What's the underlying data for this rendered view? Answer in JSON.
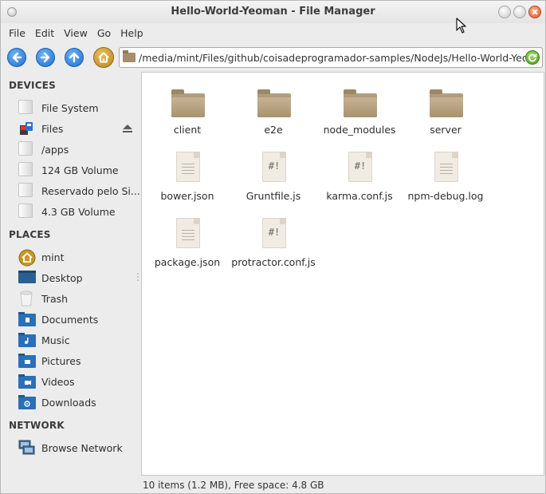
{
  "window": {
    "title": "Hello-World-Yeoman - File Manager"
  },
  "menubar": {
    "items": [
      "File",
      "Edit",
      "View",
      "Go",
      "Help"
    ]
  },
  "toolbar": {
    "back_icon": "back-arrow-icon",
    "forward_icon": "forward-arrow-icon",
    "up_icon": "up-arrow-icon",
    "home_icon": "home-icon",
    "path": "/media/mint/Files/github/coisadeprogramador-samples/NodeJs/Hello-World-Yeoman/",
    "reload_icon": "reload-icon"
  },
  "sidebar": {
    "devices": {
      "heading": "DEVICES",
      "items": [
        {
          "label": "File System",
          "icon": "drive-icon"
        },
        {
          "label": "Files",
          "icon": "removable-drive-icon"
        },
        {
          "label": "/apps",
          "icon": "drive-icon"
        },
        {
          "label": "124 GB Volume",
          "icon": "drive-icon"
        },
        {
          "label": "Reservado pelo Si...",
          "icon": "drive-icon"
        },
        {
          "label": "4.3 GB Volume",
          "icon": "drive-icon"
        }
      ]
    },
    "places": {
      "heading": "PLACES",
      "items": [
        {
          "label": "mint",
          "icon": "home-folder-icon"
        },
        {
          "label": "Desktop",
          "icon": "desktop-icon"
        },
        {
          "label": "Trash",
          "icon": "trash-icon"
        },
        {
          "label": "Documents",
          "icon": "documents-folder-icon"
        },
        {
          "label": "Music",
          "icon": "music-folder-icon"
        },
        {
          "label": "Pictures",
          "icon": "pictures-folder-icon"
        },
        {
          "label": "Videos",
          "icon": "videos-folder-icon"
        },
        {
          "label": "Downloads",
          "icon": "downloads-folder-icon"
        }
      ]
    },
    "network": {
      "heading": "NETWORK",
      "items": [
        {
          "label": "Browse Network",
          "icon": "network-icon"
        }
      ]
    }
  },
  "files": [
    {
      "name": "client",
      "type": "folder"
    },
    {
      "name": "e2e",
      "type": "folder"
    },
    {
      "name": "node_modules",
      "type": "folder"
    },
    {
      "name": "server",
      "type": "folder"
    },
    {
      "name": "bower.json",
      "type": "text"
    },
    {
      "name": "Gruntfile.js",
      "type": "script"
    },
    {
      "name": "karma.conf.js",
      "type": "script"
    },
    {
      "name": "npm-debug.log",
      "type": "text"
    },
    {
      "name": "package.json",
      "type": "text"
    },
    {
      "name": "protractor.conf.js",
      "type": "script"
    }
  ],
  "status": {
    "text": "10 items (1.2 MB), Free space: 4.8 GB"
  },
  "colors": {
    "nav_blue": "#2a7bdc",
    "home_gold": "#c9962a",
    "close_orange": "#e2562a",
    "folder_tan": "#b09c7a"
  }
}
